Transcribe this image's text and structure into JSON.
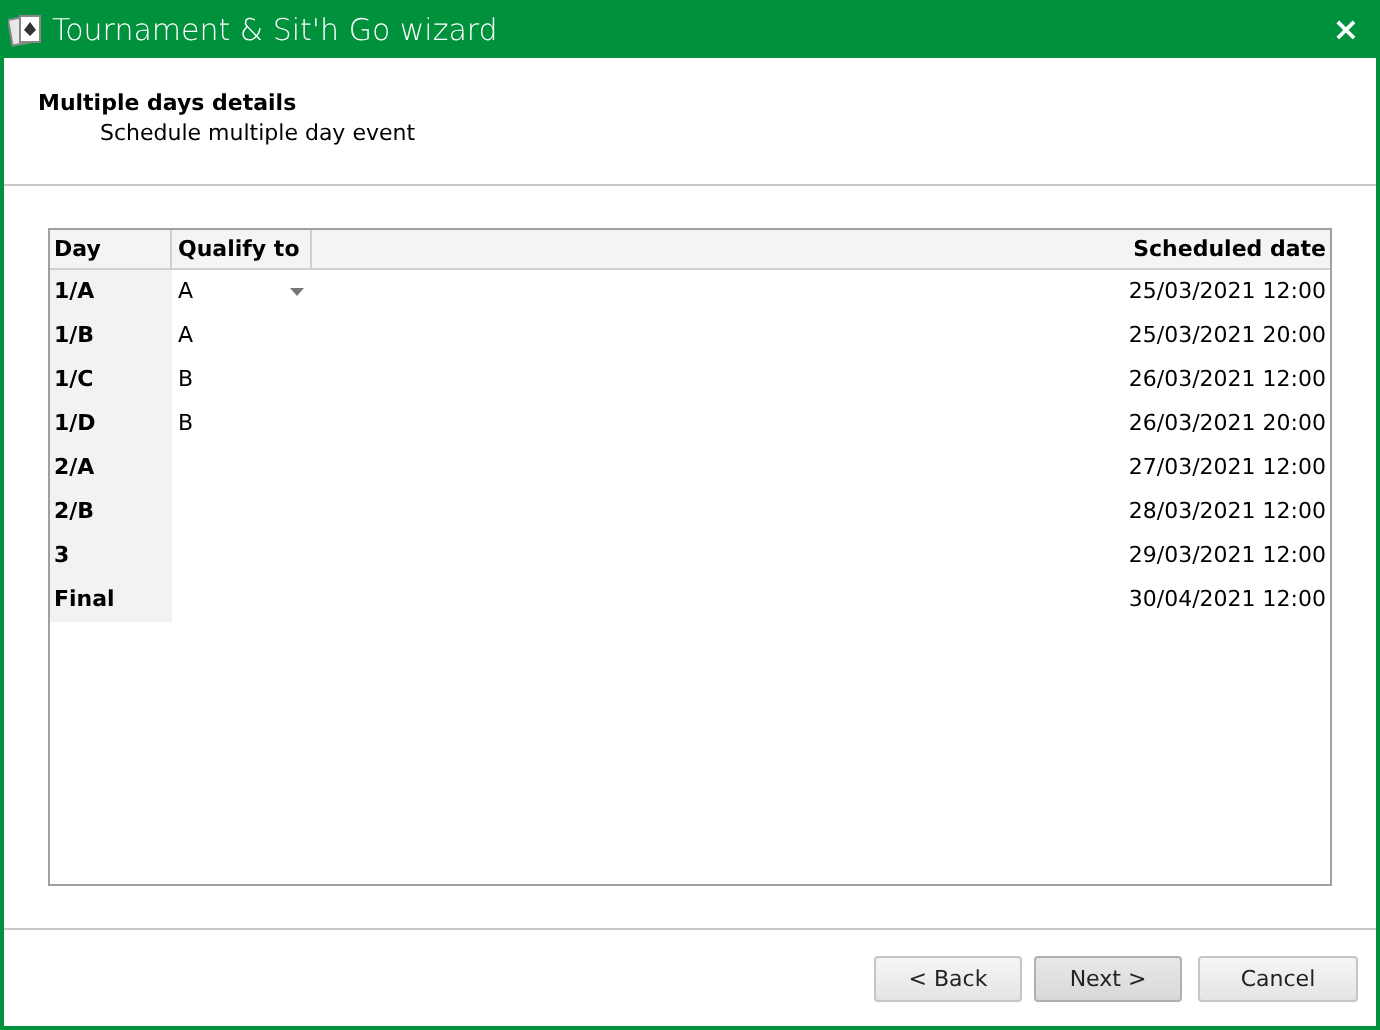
{
  "window": {
    "title": "Tournament & Sit'h Go wizard",
    "close": "×"
  },
  "header": {
    "title": "Multiple days details",
    "subtitle": "Schedule multiple day event"
  },
  "table": {
    "columns": [
      "Day",
      "Qualify to",
      "Scheduled date"
    ],
    "rows": [
      {
        "day": "1/A",
        "qualify_to": "A",
        "scheduled_date": "25/03/2021 12:00",
        "dropdown": true
      },
      {
        "day": "1/B",
        "qualify_to": "A",
        "scheduled_date": "25/03/2021 20:00"
      },
      {
        "day": "1/C",
        "qualify_to": "B",
        "scheduled_date": "26/03/2021 12:00"
      },
      {
        "day": "1/D",
        "qualify_to": "B",
        "scheduled_date": "26/03/2021 20:00"
      },
      {
        "day": "2/A",
        "scheduled_date": "27/03/2021 12:00"
      },
      {
        "day": "2/B",
        "scheduled_date": "28/03/2021 12:00"
      },
      {
        "day": "3",
        "scheduled_date": "29/03/2021 12:00"
      },
      {
        "day": "Final",
        "scheduled_date": "30/04/2021 12:00"
      }
    ]
  },
  "buttons": [
    {
      "label": "< Back",
      "highlighted": false
    },
    {
      "label": "Next >",
      "highlighted": true
    },
    {
      "label": "Cancel",
      "highlighted": false
    }
  ]
}
